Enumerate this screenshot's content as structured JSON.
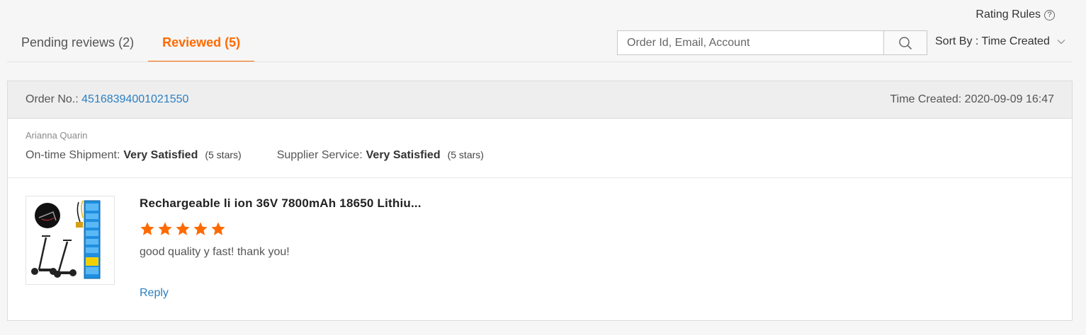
{
  "header": {
    "rating_rules": "Rating Rules",
    "rating_rules_icon": "?"
  },
  "tabs": [
    {
      "label": "Pending reviews (2)",
      "active": false
    },
    {
      "label": "Reviewed (5)",
      "active": true
    }
  ],
  "search": {
    "placeholder": "Order Id, Email, Account",
    "value": "",
    "icon": "search-icon"
  },
  "sort": {
    "label": "Sort By : Time Created",
    "icon": "chevron-down-icon"
  },
  "review": {
    "order_label": "Order No.:",
    "order_number": "45168394001021550",
    "time_created": "Time Created: 2020-09-09 16:47",
    "buyer_name": "Arianna Quarin",
    "shipment_label": "On-time Shipment:",
    "shipment_value": "Very Satisfied",
    "shipment_stars": "(5 stars)",
    "service_label": "Supplier Service:",
    "service_value": "Very Satisfied",
    "service_stars": "(5 stars)",
    "product_title": "Rechargeable li ion 36V 7800mAh 18650 Lithiu...",
    "rating": 5,
    "rating_max": 5,
    "comment": "good quality y fast! thank you!",
    "reply_label": "Reply"
  },
  "colors": {
    "accent": "#ff6a00",
    "link": "#2b7fc1",
    "star": "#ff6a00"
  }
}
